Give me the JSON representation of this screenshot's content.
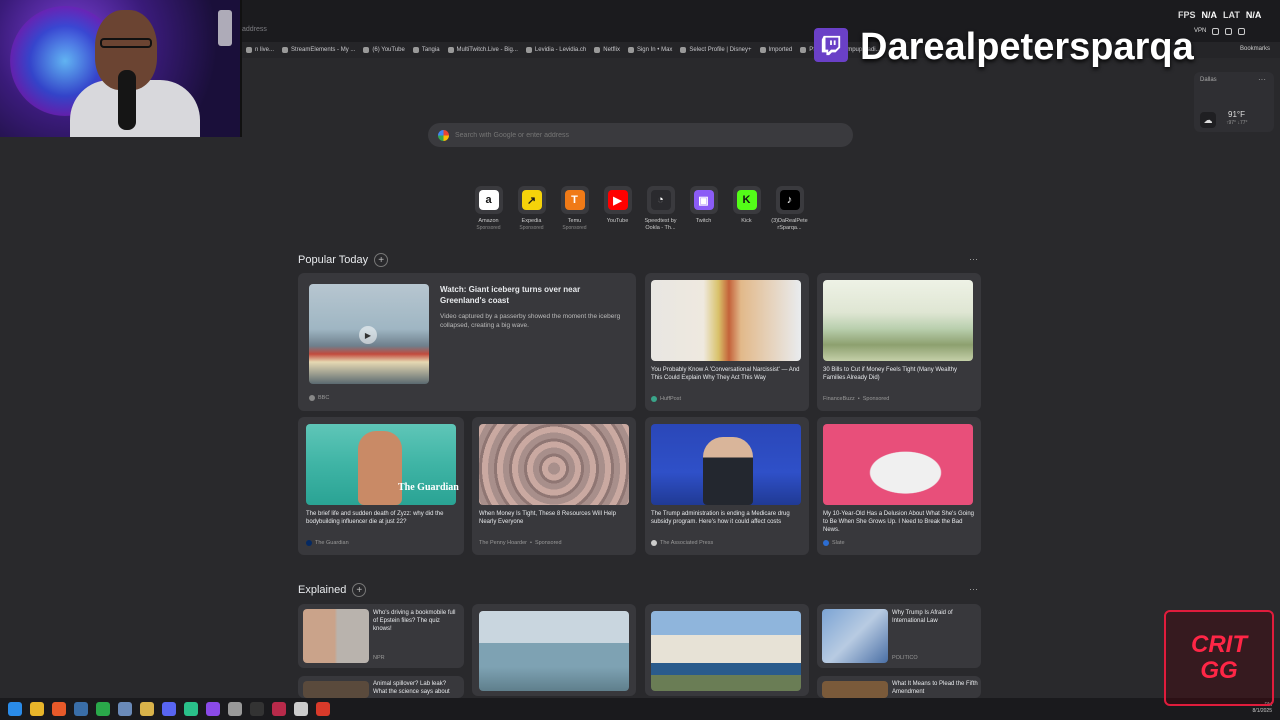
{
  "browser": {
    "address_placeholder": "address",
    "bookmarks": [
      "n live...",
      "StreamElements - My ...",
      "(6) YouTube",
      "Tangia",
      "MultiTwitch.Live - Big...",
      "Levidia - Levidia.ch",
      "Netflix",
      "Sign In • Max",
      "Select Profile | Disney+",
      "Imported",
      "PS2 ISOs - ...impuparadi..."
    ],
    "bookmarks_right": "Bookmarks"
  },
  "overlay": {
    "channel_name": "Darealpetersparqa",
    "fps_label": "FPS",
    "fps_value": "N/A",
    "lat_label": "LAT",
    "lat_value": "N/A",
    "vpn_label": "VPN"
  },
  "weather": {
    "city": "Dallas",
    "temp": "91°F",
    "hilo": "↑97°  ↓77°",
    "icon": "cloud-icon"
  },
  "search": {
    "placeholder": "Search with Google or enter address"
  },
  "shortcuts": [
    {
      "label": "Amazon",
      "sub": "Sponsored",
      "glyph": "a",
      "bg": "#ffffff",
      "fg": "#111111"
    },
    {
      "label": "Expedia",
      "sub": "Sponsored",
      "glyph": "↗",
      "bg": "#f5d30a",
      "fg": "#1a1a1a"
    },
    {
      "label": "Temu",
      "sub": "Sponsored",
      "glyph": "T",
      "bg": "#f07a17",
      "fg": "#ffffff"
    },
    {
      "label": "YouTube",
      "sub": "",
      "glyph": "▶",
      "bg": "#ff0000",
      "fg": "#ffffff"
    },
    {
      "label": "Speedtest by Ookla - Th...",
      "sub": "",
      "glyph": "◔",
      "bg": "#2a2a2e",
      "fg": "#ffffff"
    },
    {
      "label": "Twitch",
      "sub": "",
      "glyph": "▣",
      "bg": "#8b5cf6",
      "fg": "#ffffff"
    },
    {
      "label": "Kick",
      "sub": "",
      "glyph": "K",
      "bg": "#53fc18",
      "fg": "#111111"
    },
    {
      "label": "(3)DaRealPete rSparqa...",
      "sub": "",
      "glyph": "♪",
      "bg": "#000000",
      "fg": "#ffffff"
    }
  ],
  "popular": {
    "heading": "Popular Today",
    "hero": {
      "title": "Watch: Giant iceberg turns over near Greenland's coast",
      "desc": "Video captured by a passerby showed the moment the iceberg collapsed, creating a big wave.",
      "source": "BBC"
    },
    "cards": [
      {
        "title": "You Probably Know A 'Conversational Narcissist' — And This Could Explain Why They Act This Way",
        "source": "HuffPost",
        "sponsored": ""
      },
      {
        "title": "30 Bills to Cut if Money Feels Tight (Many Wealthy Families Already Did)",
        "source": "FinanceBuzz",
        "sponsored": "Sponsored"
      },
      {
        "title": "The brief life and sudden death of Zyzz: why did the bodybuilding influencer die at just 22?",
        "source": "The Guardian",
        "sponsored": ""
      },
      {
        "title": "When Money Is Tight, These 8 Resources Will Help Nearly Everyone",
        "source": "The Penny Hoarder",
        "sponsored": "Sponsored"
      },
      {
        "title": "The Trump administration is ending a Medicare drug subsidy program. Here's how it could affect costs",
        "source": "The Associated Press",
        "sponsored": ""
      },
      {
        "title": "My 10-Year-Old Has a Delusion About What She's Going to Be When She Grows Up. I Need to Break the Bad News.",
        "source": "Slate",
        "sponsored": ""
      }
    ],
    "guardian_mark": "The Guardian"
  },
  "explained": {
    "heading": "Explained",
    "cards": [
      {
        "title": "Who's driving a bookmobile full of Epstein files? The quiz knows!",
        "source": "NPR"
      },
      {
        "title": "Why Trump Is Afraid of International Law",
        "source": "POLITICO"
      },
      {
        "title": "Animal spillover? Lab leak? What the science says about",
        "source": ""
      },
      {
        "title": "What It Means to Plead the Fifth Amendment",
        "source": ""
      }
    ]
  },
  "tray": {
    "time": "...PM",
    "date": "8/1/2025"
  },
  "crit_logo": [
    "CRIT",
    "GG"
  ]
}
